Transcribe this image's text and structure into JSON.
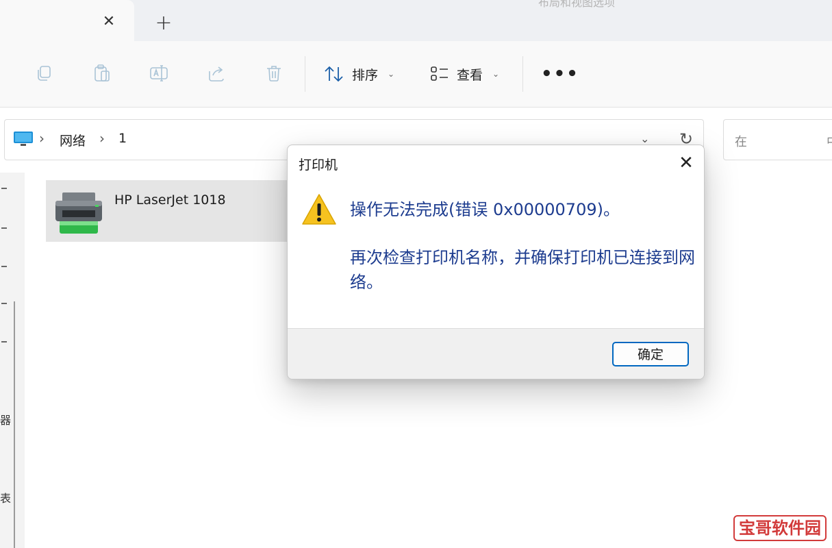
{
  "tabs": {
    "close_icon": "close-icon",
    "new_tab_icon": "plus-icon",
    "hint_text": "布局和视图选项"
  },
  "toolbar": {
    "icons": [
      "copy-icon",
      "paste-icon",
      "rename-icon",
      "share-icon",
      "delete-icon"
    ],
    "sort_label": "排序",
    "view_label": "查看",
    "more_label": "•••"
  },
  "address": {
    "crumbs": [
      "网络",
      "1"
    ],
    "search_placeholder": "在",
    "search_placeholder_tail": "中"
  },
  "content": {
    "items": [
      {
        "name": "HP LaserJet 1018",
        "icon": "printer-icon"
      }
    ]
  },
  "nav": {
    "partial_labels": [
      "器",
      "表"
    ]
  },
  "dialog": {
    "title": "打印机",
    "message_main": "操作无法完成(错误 0x00000709)。",
    "message_detail": "再次检查打印机名称，并确保打印机已连接到网络。",
    "ok_label": "确定",
    "warning_icon": "warning-icon"
  },
  "watermark": "宝哥软件园",
  "colors": {
    "message_text": "#1d3c8f",
    "ok_border": "#0067c0",
    "watermark": "#d23a3a",
    "warning": "#f6c220"
  }
}
